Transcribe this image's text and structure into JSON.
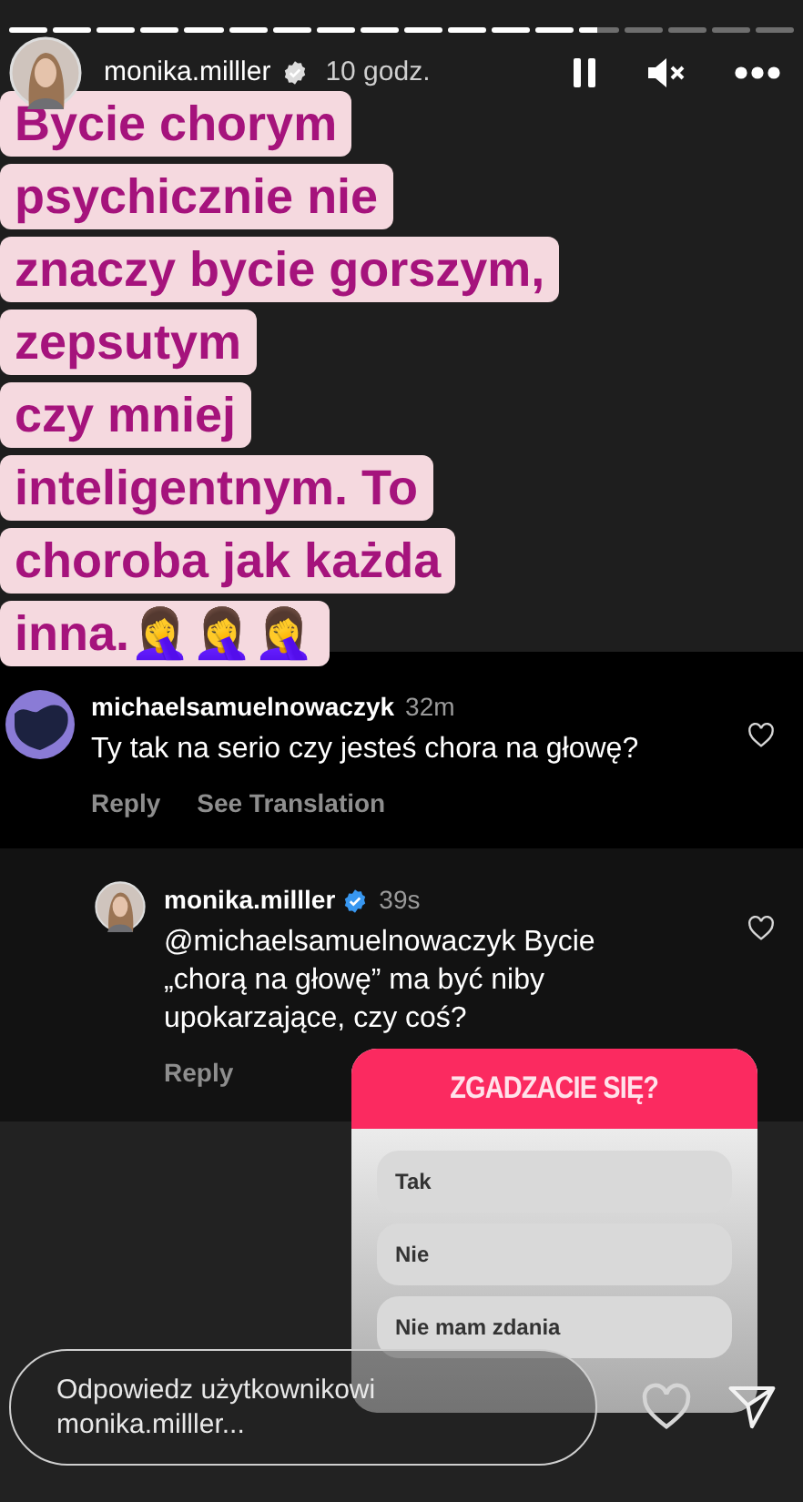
{
  "progress": [
    {
      "level": 1
    },
    {
      "level": 1
    },
    {
      "level": 1
    },
    {
      "level": 1
    },
    {
      "level": 1
    },
    {
      "level": 1
    },
    {
      "level": 1
    },
    {
      "level": 1
    },
    {
      "level": 1
    },
    {
      "level": 1
    },
    {
      "level": 1
    },
    {
      "level": 1
    },
    {
      "level": 1
    },
    {
      "level": 0.45
    },
    {
      "level": 0
    },
    {
      "level": 0
    },
    {
      "level": 0
    },
    {
      "level": 0
    }
  ],
  "header": {
    "username": "monika.milller",
    "verified": true,
    "time": "10 godz.",
    "paused": false,
    "muted": true
  },
  "story": {
    "lines": [
      "Bycie chorym",
      "psychicznie nie",
      "znaczy bycie gorszym,",
      "zepsutym",
      "czy mniej",
      "inteligentnym. To",
      "choroba jak każda",
      "inna.🤦‍♀️🤦‍♀️🤦‍♀️"
    ]
  },
  "comments": [
    {
      "kind": "comment",
      "username": "michaelsamuelnowaczyk",
      "verified": false,
      "time": "32m",
      "text": "Ty tak na serio czy jesteś chora na głowę?",
      "actions": [
        "Reply",
        "See Translation"
      ],
      "liked": false
    },
    {
      "kind": "reply",
      "username": "monika.milller",
      "verified": true,
      "time": "39s",
      "text": "@michaelsamuelnowaczyk Bycie „chorą na głowę” ma być niby upokarzające, czy coś?",
      "actions": [
        "Reply"
      ],
      "liked": false
    }
  ],
  "poll": {
    "question": "ZGADZACIE SIĘ?",
    "options": [
      "Tak",
      "Nie",
      "Nie mam zdania"
    ]
  },
  "reply_field": {
    "placeholder": "Odpowiedz użytkownikowi monika.milller..."
  }
}
